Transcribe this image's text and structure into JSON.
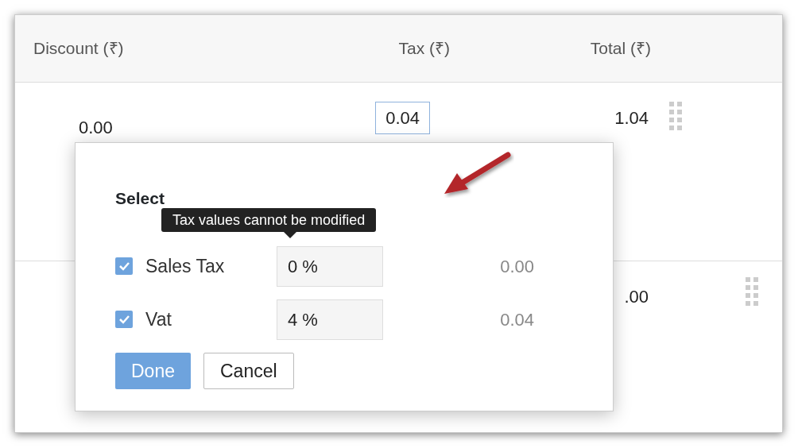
{
  "table": {
    "columns": [
      "Discount (₹)",
      "Tax (₹)",
      "Total (₹)"
    ],
    "rows": [
      {
        "discount": "0.00",
        "tax": "0.04",
        "tax_focused": true,
        "total": "1.04"
      },
      {
        "total": ".00"
      }
    ]
  },
  "popover": {
    "heading": "Select",
    "tooltip": "Tax values cannot be modified",
    "taxes": [
      {
        "name": "Sales Tax",
        "checked": true,
        "rate": "0 %",
        "amount": "0.00"
      },
      {
        "name": "Vat",
        "checked": true,
        "rate": "4 %",
        "amount": "0.04"
      }
    ],
    "buttons": [
      {
        "label": "Done",
        "kind": "primary"
      },
      {
        "label": "Cancel",
        "kind": "secondary"
      }
    ]
  }
}
